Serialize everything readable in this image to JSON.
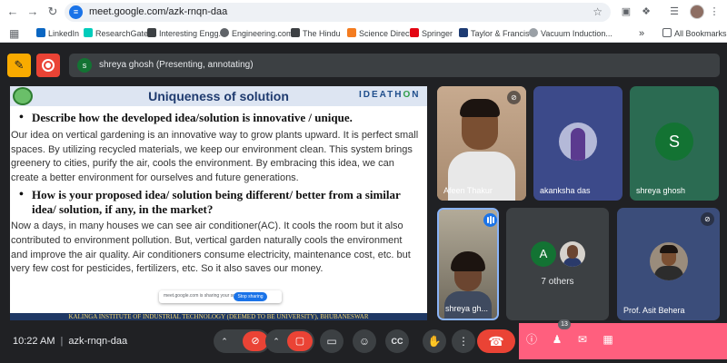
{
  "browser": {
    "url": "meet.google.com/azk-rnqn-daa",
    "bookmarks": [
      {
        "label": "LinkedIn",
        "color": "#0a66c2"
      },
      {
        "label": "ResearchGate",
        "color": "#00ccbb"
      },
      {
        "label": "Interesting Engg.",
        "color": "#3c4043"
      },
      {
        "label": "Engineering.com",
        "color": "#5f6368"
      },
      {
        "label": "The Hindu",
        "color": "#3c4043"
      },
      {
        "label": "Science Direct",
        "color": "#f47c20"
      },
      {
        "label": "Springer",
        "color": "#e30613"
      },
      {
        "label": "Taylor & Francis",
        "color": "#1d3b73"
      },
      {
        "label": "Vacuum Induction...",
        "color": "#9aa0a6"
      }
    ],
    "all_bookmarks": "All Bookmarks"
  },
  "meet": {
    "presenting_avatar": "s",
    "presenting_text": "shreya ghosh (Presenting, annotating)",
    "slide": {
      "title": "Uniqueness of solution",
      "logo_right_text": "IDEATH",
      "logo_right_o": "O",
      "logo_right_end": "N",
      "q1": "Describe how the developed idea/solution is innovative / unique.",
      "p1": "Our idea on vertical gardening is an innovative way to grow plants upward. It is perfect  small spaces. By utilizing recycled materials, we keep our environment clean. This system brings greenery to cities, purify the air, cools the environment. By embracing this idea, we can create a better environment for ourselves and future generations.",
      "q2": "How is your proposed idea/ solution being different/ better from a similar idea/ solution, if any, in the market?",
      "p2": "Now a days, in many houses we can see air conditioner(AC). It cools the room but it also contributed to environment pollution. But, vertical garden naturally cools the environment and improve the air quality. Air conditioners consume electricity, maintenance cost, etc. but very few cost for pesticides, fertilizers, etc. So it also saves our money.",
      "footer": "KALINGA INSTITUTE OF INDUSTRIAL TECHNOLOGY (DEEMED TO BE UNIVERSITY), BHUBANESWAR",
      "share_notice": "meet.google.com is sharing your screen.",
      "stop_sharing": "Stop sharing"
    },
    "tiles": {
      "t1_name": "Afeen Thakur",
      "t2_name": "akanksha das",
      "t3_name": "shreya ghosh",
      "t3_initial": "S",
      "t4_name": "shreya gh...",
      "t5_initial": "A",
      "t5_others": "7 others",
      "t6_name": "Prof. Asit Behera"
    },
    "bottom": {
      "time": "10:22 AM",
      "code": "azk-rnqn-daa",
      "people_count": "13"
    }
  }
}
